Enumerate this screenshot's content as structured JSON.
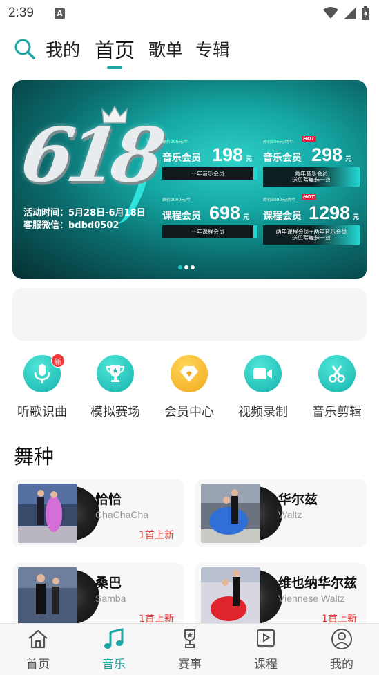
{
  "status": {
    "time": "2:39",
    "notif_letter": "A"
  },
  "topnav": {
    "tabs": [
      {
        "label": "我的"
      },
      {
        "label": "首页"
      },
      {
        "label": "歌单"
      },
      {
        "label": "专辑"
      }
    ],
    "active": "首页"
  },
  "banner": {
    "big_text": "618",
    "activity_time": "活动时间：5月28日-6月18日",
    "service_wechat": "客服微信：bdbd0502",
    "cards": [
      {
        "orig": "原价298元/年",
        "name": "音乐会员",
        "price": "198",
        "unit": "元",
        "desc": "一年音乐会员",
        "hot": ""
      },
      {
        "orig": "原价596元/两年",
        "name": "音乐会员",
        "price": "298",
        "unit": "元",
        "desc_1": "两年音乐会员",
        "desc_2": "送贝蒂舞鞋一双",
        "hot": "HOT"
      },
      {
        "orig": "原价2990元/年",
        "name": "课程会员",
        "price": "698",
        "unit": "元",
        "desc": "一年课程会员",
        "hot": ""
      },
      {
        "orig": "原价3990元/两年",
        "name": "课程会员",
        "price": "1298",
        "unit": "元",
        "desc_1": "两年课程会员+两年音乐会员",
        "desc_2": "送贝蒂舞鞋一双",
        "hot": "HOT"
      }
    ],
    "dots_total": 3,
    "dots_active": 0
  },
  "shortcuts": [
    {
      "label": "听歌识曲",
      "icon": "microphone-icon",
      "badge": "新"
    },
    {
      "label": "模拟赛场",
      "icon": "trophy-icon"
    },
    {
      "label": "会员中心",
      "icon": "diamond-icon"
    },
    {
      "label": "视频录制",
      "icon": "video-camera-icon"
    },
    {
      "label": "音乐剪辑",
      "icon": "scissors-icon"
    }
  ],
  "section": {
    "title": "舞种"
  },
  "dances": [
    {
      "name": "恰恰",
      "en": "ChaChaCha",
      "new": "1首上新"
    },
    {
      "name": "华尔兹",
      "en": "Waltz",
      "new": ""
    },
    {
      "name": "桑巴",
      "en": "Samba",
      "new": "1首上新"
    },
    {
      "name": "维也纳华尔兹",
      "en": "Viennese Waltz",
      "new": "1首上新"
    }
  ],
  "tabbar": [
    {
      "label": "首页",
      "icon": "home-icon"
    },
    {
      "label": "音乐",
      "icon": "music-note-icon"
    },
    {
      "label": "赛事",
      "icon": "medal-icon"
    },
    {
      "label": "课程",
      "icon": "video-book-icon"
    },
    {
      "label": "我的",
      "icon": "user-icon"
    }
  ],
  "colors": {
    "accent": "#1aa6a3",
    "new_red": "#e53935",
    "gold": "#f0a81a"
  }
}
